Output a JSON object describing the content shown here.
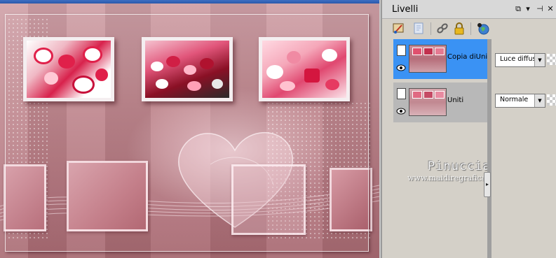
{
  "panel": {
    "title": "Livelli",
    "header_buttons": [
      "⧉",
      "▾",
      "⊣",
      "✕"
    ]
  },
  "layers": [
    {
      "name": "Copia diUniti",
      "blend_mode": "Luce diffusa",
      "selected": true
    },
    {
      "name": "Uniti",
      "blend_mode": "Normale",
      "selected": false
    }
  ],
  "watermark": {
    "name": "Pinuccia",
    "site": "www.maidiregrafica.eu"
  },
  "colors": {
    "selection": "#3a92f4",
    "canvas_pink": "#c0888f",
    "titlebar_blue": "#2a58ab"
  },
  "icons": [
    "paint-brush-icon",
    "mask-icon",
    "link-icon",
    "lock-icon",
    "globe-icon"
  ]
}
